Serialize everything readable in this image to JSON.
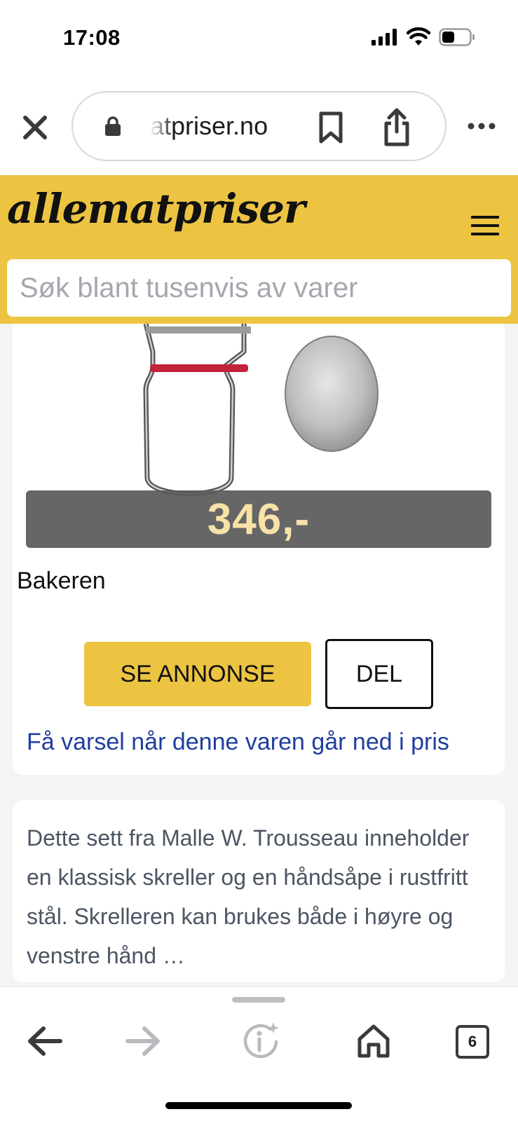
{
  "status_bar": {
    "time": "17:08"
  },
  "browser": {
    "url": "atpriser.no",
    "icons": [
      "close-icon",
      "lock-icon",
      "bookmark-icon",
      "share-icon",
      "more-icon"
    ]
  },
  "site": {
    "logo": "allematpriser",
    "search_placeholder": "Søk blant tusenvis av varer",
    "accent_color": "#ecc442"
  },
  "product": {
    "price": "346,-",
    "store": "Bakeren",
    "see_ad_label": "SE ANNONSE",
    "share_label": "DEL",
    "price_alert_link": "Få varsel når denne varen går ned i pris",
    "description": "Dette sett fra Malle W. Trousseau inneholder en klassisk skreller og en håndsåpe i rustfritt stål. Skrelleren kan brukes både i høyre og venstre hånd …"
  },
  "toolbar": {
    "tab_count": "6",
    "icons": [
      "back-arrow-icon",
      "forward-arrow-icon",
      "info-sparkle-icon",
      "home-icon",
      "tabs-icon"
    ]
  }
}
